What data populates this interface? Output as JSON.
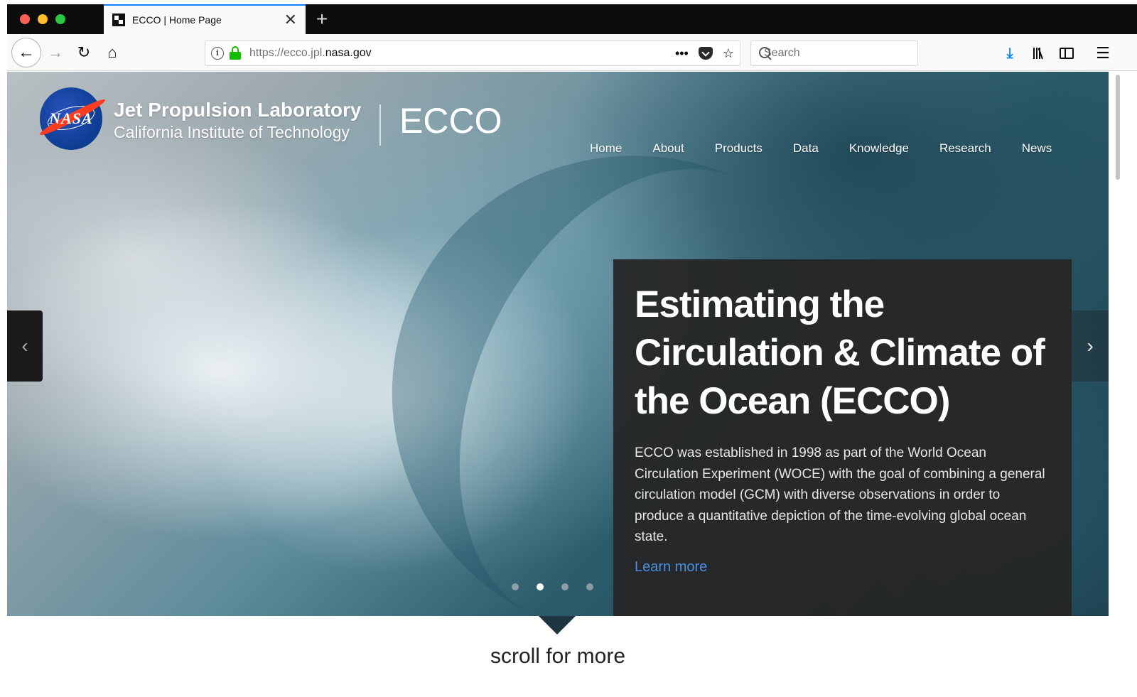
{
  "browser": {
    "tab": {
      "title": "ECCO | Home Page",
      "close_glyph": "✕",
      "favicon": "ecco-favicon"
    },
    "new_tab_glyph": "+",
    "nav": {
      "back_glyph": "←",
      "forward_glyph": "→",
      "reload_glyph": "↻",
      "home_glyph": "⌂"
    },
    "url": {
      "scheme_host_prefix": "https://ecco.jpl.",
      "host_domain": "nasa.gov"
    },
    "url_actions": {
      "more_glyph": "•••",
      "bookmark_glyph": "☆"
    },
    "search": {
      "placeholder": "Search",
      "value": ""
    },
    "toolbar": {
      "download_glyph": "⤓",
      "menu_glyph": "☰"
    },
    "colors": {
      "accent": "#0a84ff",
      "lock": "#12bc00"
    }
  },
  "site": {
    "logo": "NASA",
    "org_name": "Jet Propulsion Laboratory",
    "org_sub": "California Institute of Technology",
    "title": "ECCO",
    "nav": [
      "Home",
      "About",
      "Products",
      "Data",
      "Knowledge",
      "Research",
      "News"
    ]
  },
  "hero": {
    "heading": "Estimating the Circulation & Climate of the Ocean (ECCO)",
    "body": "ECCO was established in 1998 as part of the World Ocean Circulation Experiment (WOCE) with the goal of combining a general circulation model (GCM) with diverse observations in order to produce a quantitative depiction of the time-evolving global ocean state.",
    "link": "Learn more",
    "prev_glyph": "‹",
    "next_glyph": "›",
    "slide_count": 4,
    "active_slide": 2,
    "link_color": "#4a90e2"
  },
  "footer": {
    "scroll_text": "scroll for more"
  }
}
